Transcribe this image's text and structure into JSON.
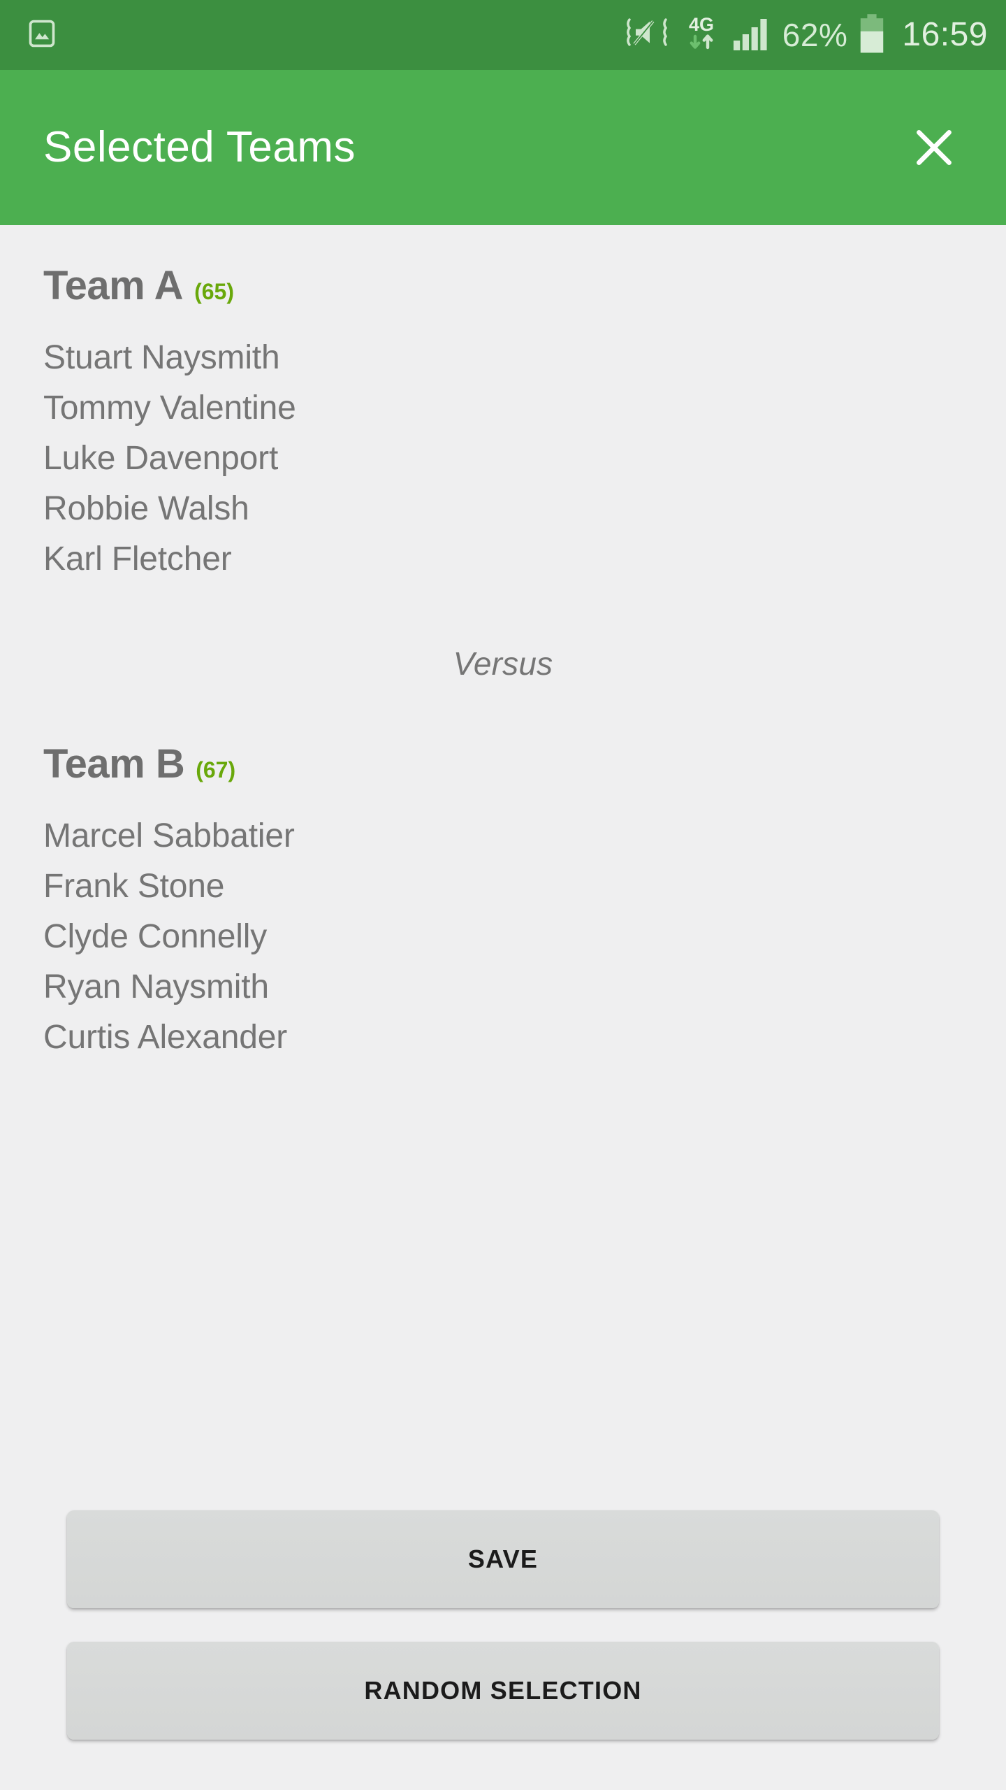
{
  "status_bar": {
    "background_color": "#3c8f40",
    "icons": [
      {
        "name": "screenshot-image-icon",
        "label": "image"
      },
      {
        "name": "volume-mute-vibrate-icon",
        "label": "mute"
      },
      {
        "name": "network-4g-icon",
        "label": "4G"
      },
      {
        "name": "signal-bars-icon",
        "label": "signal"
      },
      {
        "name": "battery-icon",
        "label": "battery"
      }
    ],
    "network_label": "4G",
    "battery_percent": "62%",
    "battery_level": 62,
    "time": "16:59"
  },
  "app_bar": {
    "title": "Selected Teams",
    "close_label": "✕",
    "background_color": "#4caf50",
    "title_color": "#ffffff"
  },
  "content": {
    "background_color": "#efeff0",
    "versus_label": "Versus",
    "count_color": "#69a80b",
    "text_color": "#757575",
    "teams": [
      {
        "name": "Team A",
        "count": "(65)",
        "players": [
          "Stuart Naysmith",
          "Tommy Valentine",
          "Luke Davenport",
          "Robbie Walsh",
          "Karl Fletcher"
        ]
      },
      {
        "name": "Team B",
        "count": "(67)",
        "players": [
          "Marcel Sabbatier",
          "Frank Stone",
          "Clyde Connelly",
          "Ryan Naysmith",
          "Curtis Alexander"
        ]
      }
    ]
  },
  "buttons": {
    "save_label": "SAVE",
    "random_selection_label": "RANDOM SELECTION"
  }
}
